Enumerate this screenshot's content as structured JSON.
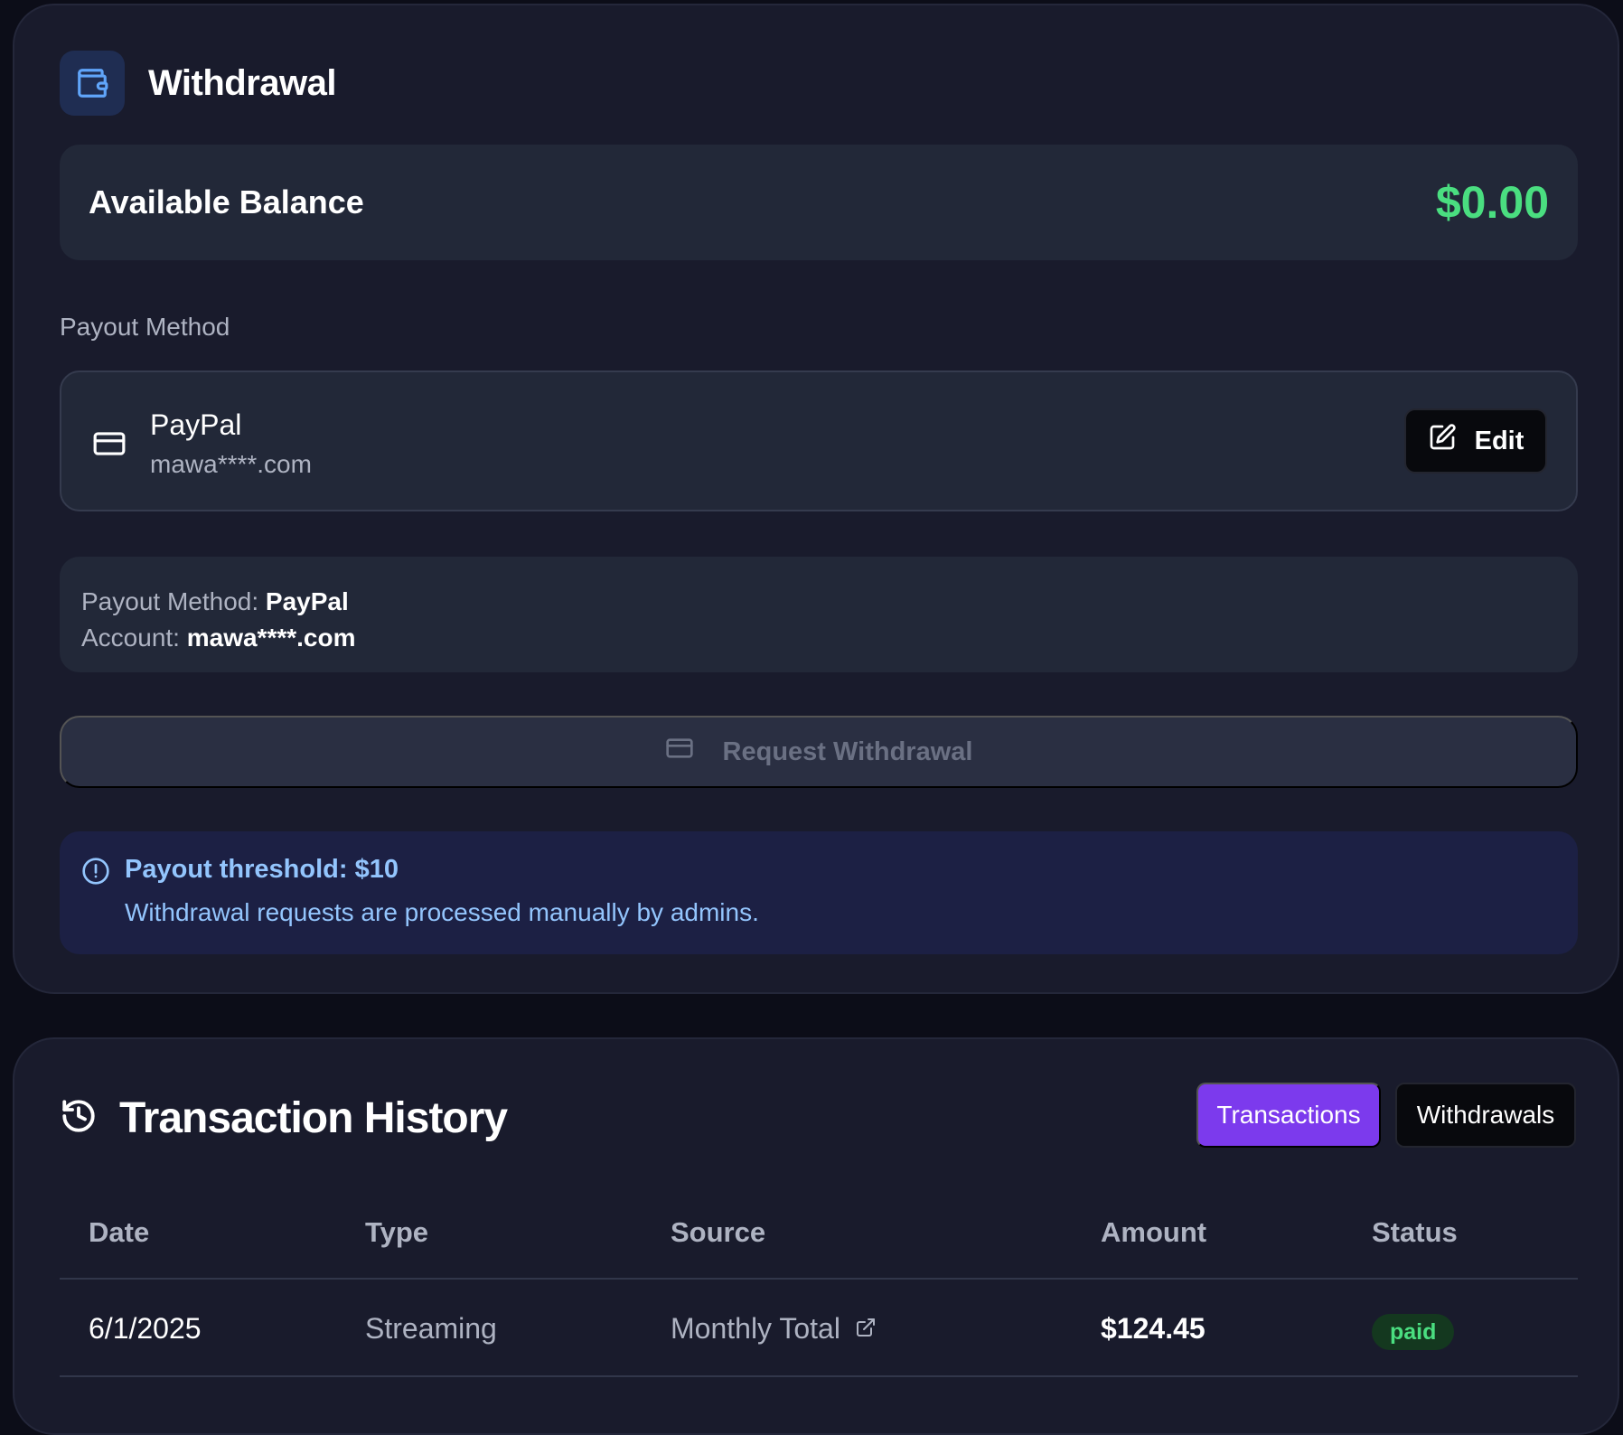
{
  "withdrawal": {
    "title": "Withdrawal",
    "wallet_icon": "wallet-icon",
    "balance_label": "Available Balance",
    "balance_value": "$0.00",
    "payout_method_label": "Payout Method",
    "method": {
      "icon": "credit-card-icon",
      "name": "PayPal",
      "account": "mawa****.com",
      "edit_label": "Edit"
    },
    "summary": {
      "method_key": "Payout Method:",
      "method_value": "PayPal",
      "account_key": "Account:",
      "account_value": "mawa****.com"
    },
    "request_label": "Request Withdrawal",
    "notice": {
      "icon": "info-circle-icon",
      "title": "Payout threshold: $10",
      "body": "Withdrawal requests are processed manually by admins."
    }
  },
  "history": {
    "title": "Transaction History",
    "icon": "history-icon",
    "tabs": [
      {
        "label": "Transactions",
        "active": true
      },
      {
        "label": "Withdrawals",
        "active": false
      }
    ],
    "columns": [
      "Date",
      "Type",
      "Source",
      "Amount",
      "Status"
    ],
    "rows": [
      {
        "date": "6/1/2025",
        "type": "Streaming",
        "source": "Monthly Total",
        "amount": "$124.45",
        "status": "paid"
      }
    ]
  },
  "colors": {
    "accent": "#7c3aed",
    "positive": "#4ade80",
    "info": "#93c5fd",
    "card": "#191b2c",
    "panel": "#222838"
  }
}
